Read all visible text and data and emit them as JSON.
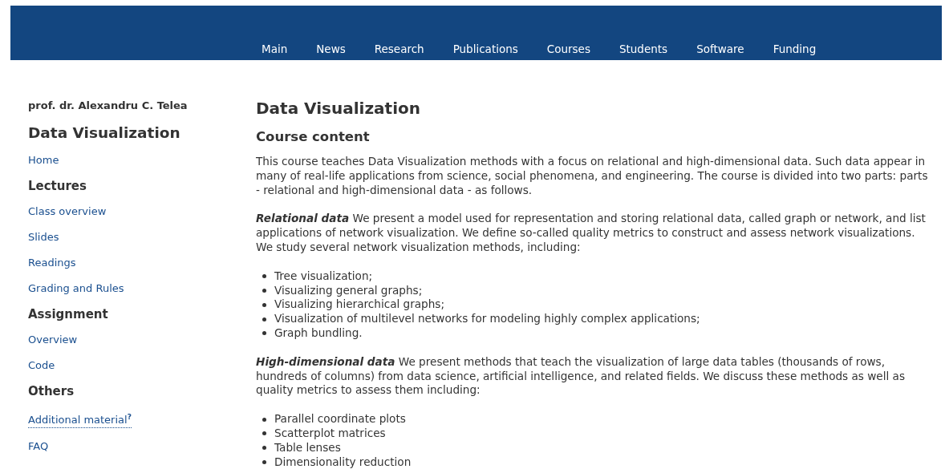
{
  "nav": [
    {
      "label": "Main"
    },
    {
      "label": "News"
    },
    {
      "label": "Research"
    },
    {
      "label": "Publications"
    },
    {
      "label": "Courses"
    },
    {
      "label": "Students"
    },
    {
      "label": "Software"
    },
    {
      "label": "Funding"
    }
  ],
  "sidebar": {
    "author": "prof. dr. Alexandru C. Telea",
    "title": "Data Visualization",
    "items": [
      {
        "kind": "link",
        "label": "Home"
      },
      {
        "kind": "heading",
        "label": "Lectures"
      },
      {
        "kind": "link",
        "label": "Class overview"
      },
      {
        "kind": "link",
        "label": "Slides"
      },
      {
        "kind": "link",
        "label": "Readings"
      },
      {
        "kind": "link",
        "label": "Grading and Rules"
      },
      {
        "kind": "heading",
        "label": "Assignment"
      },
      {
        "kind": "link",
        "label": "Overview"
      },
      {
        "kind": "link",
        "label": "Code"
      },
      {
        "kind": "heading",
        "label": "Others"
      },
      {
        "kind": "tooltip-link",
        "label": "Additional material$^{?}$"
      },
      {
        "kind": "link",
        "label": "FAQ"
      }
    ]
  },
  "main": {
    "title": "Data Visualization",
    "subtitle": "Course content",
    "blocks": [
      {
        "kind": "paragraph",
        "text": "This course teaches Data Visualization methods with a focus on relational and high-dimensional data. Such data appear in many of real-life applications from science, social phenomena, and engineering. The course is divided into two parts: parts - relational and high-dimensional data - as follows."
      },
      {
        "kind": "paragraph",
        "text": "**Relational data** We present a model used for representation and storing relational data, called graph or network, and list applications of network visualization. We define so-called quality metrics to construct and assess network visualizations. We study several network visualization methods, including:"
      },
      {
        "kind": "list",
        "items": [
          "Tree visualization;",
          "Visualizing general graphs;",
          "Visualizing hierarchical graphs;",
          "Visualization of multilevel networks for modeling highly complex applications;",
          "Graph bundling."
        ]
      },
      {
        "kind": "paragraph",
        "text": "**High-dimensional data** We present methods that teach the visualization of large data tables (thousands of rows, hundreds of columns) from data science, artificial intelligence, and related fields. We discuss these methods as well as quality metrics to assess them including:"
      },
      {
        "kind": "list",
        "items": [
          "Parallel coordinate plots",
          "Scatterplot matrices",
          "Table lenses",
          "Dimensionality reduction"
        ]
      }
    ]
  }
}
